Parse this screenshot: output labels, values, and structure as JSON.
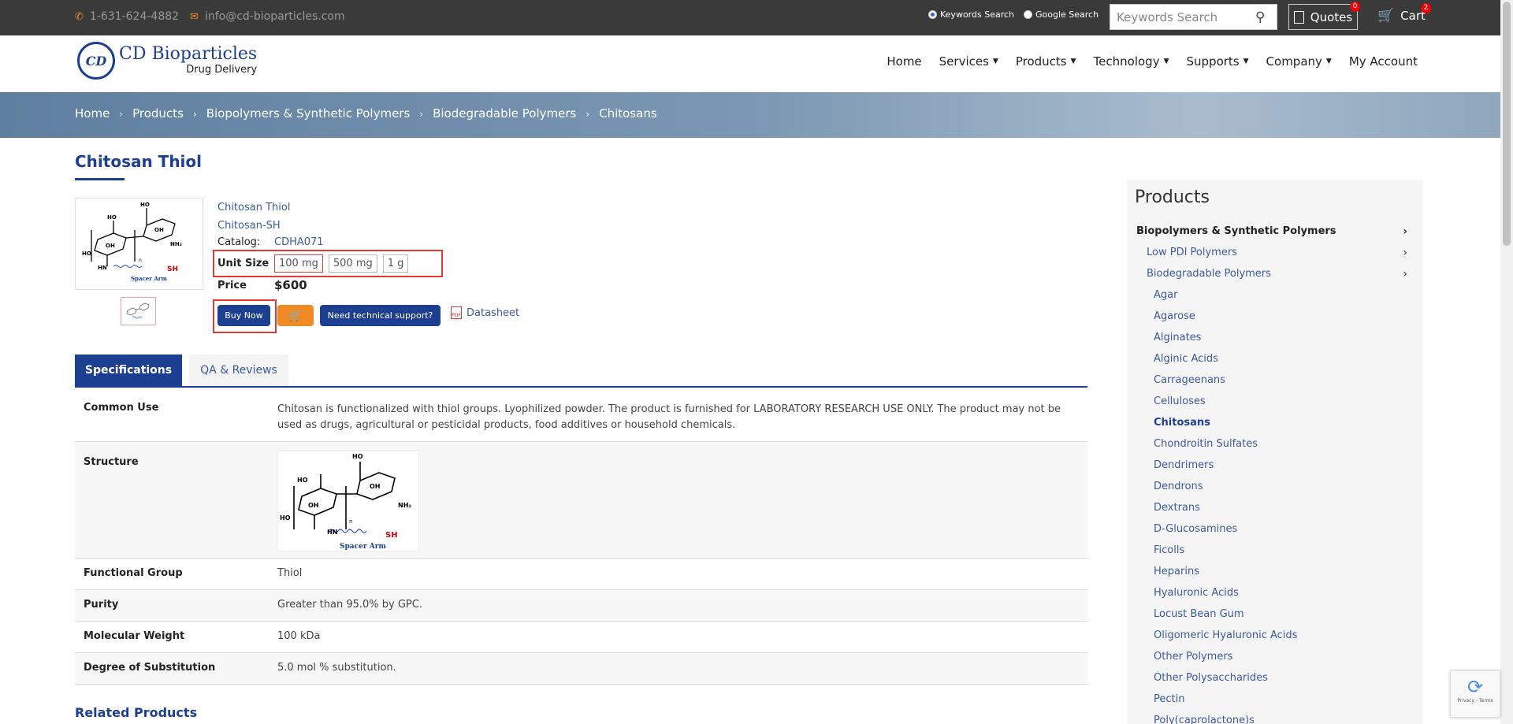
{
  "topbar": {
    "phone": "1-631-624-4882",
    "email": "info@cd-bioparticles.com",
    "radio_keywords": "Keywords Search",
    "radio_google": "Google Search",
    "search_placeholder": "Keywords Search",
    "quotes_label": "Quotes",
    "quotes_count": "0",
    "cart_label": "Cart",
    "cart_count": "2"
  },
  "logo": {
    "mark": "CD",
    "name": "CD Bioparticles",
    "subtitle": "Drug Delivery"
  },
  "nav": [
    "Home",
    "Services",
    "Products",
    "Technology",
    "Supports",
    "Company",
    "My Account"
  ],
  "breadcrumb": [
    "Home",
    "Products",
    "Biopolymers & Synthetic Polymers",
    "Biodegradable Polymers",
    "Chitosans"
  ],
  "product": {
    "title": "Chitosan Thiol",
    "name_link": "Chitosan Thiol",
    "alias_link": "Chitosan-SH",
    "catalog_label": "Catalog:",
    "catalog_value": "CDHA071",
    "unit_size_label": "Unit Size",
    "sizes": [
      "100 mg",
      "500 mg",
      "1 g"
    ],
    "price_label": "Price",
    "price_value": "$600",
    "buy_now": "Buy Now",
    "support": "Need technical support?",
    "datasheet": "Datasheet",
    "image_labels": {
      "ho": "HO",
      "oh": "OH",
      "nh2": "NH₂",
      "hn": "HN",
      "sh": "SH",
      "n": "n",
      "spacer": "Spacer Arm"
    }
  },
  "tabs": [
    "Specifications",
    "QA & Reviews"
  ],
  "specs": [
    {
      "k": "Common Use",
      "v": "Chitosan is functionalized with thiol groups. Lyophilized powder. The product is furnished for LABORATORY RESEARCH USE ONLY. The product may not be used as drugs, agricultural or pesticidal products, food additives or household chemicals."
    },
    {
      "k": "Structure",
      "v": ""
    },
    {
      "k": "Functional Group",
      "v": "Thiol"
    },
    {
      "k": "Purity",
      "v": "Greater than 95.0% by GPC."
    },
    {
      "k": "Molecular Weight",
      "v": "100 kDa"
    },
    {
      "k": "Degree of Substitution",
      "v": "5.0 mol % substitution."
    }
  ],
  "related_title": "Related Products",
  "sidebar": {
    "title": "Products",
    "items": [
      {
        "label": "Biopolymers & Synthetic Polymers",
        "level": 0,
        "arrow": true
      },
      {
        "label": "Low PDI Polymers",
        "level": 1,
        "arrow": true
      },
      {
        "label": "Biodegradable Polymers",
        "level": 1,
        "arrow": true
      },
      {
        "label": "Agar",
        "level": 2
      },
      {
        "label": "Agarose",
        "level": 2
      },
      {
        "label": "Alginates",
        "level": 2
      },
      {
        "label": "Alginic Acids",
        "level": 2
      },
      {
        "label": "Carrageenans",
        "level": 2
      },
      {
        "label": "Celluloses",
        "level": 2
      },
      {
        "label": "Chitosans",
        "level": 2,
        "current": true
      },
      {
        "label": "Chondroitin Sulfates",
        "level": 2
      },
      {
        "label": "Dendrimers",
        "level": 2
      },
      {
        "label": "Dendrons",
        "level": 2
      },
      {
        "label": "Dextrans",
        "level": 2
      },
      {
        "label": "D-Glucosamines",
        "level": 2
      },
      {
        "label": "Ficolls",
        "level": 2
      },
      {
        "label": "Heparins",
        "level": 2
      },
      {
        "label": "Hyaluronic Acids",
        "level": 2
      },
      {
        "label": "Locust Bean Gum",
        "level": 2
      },
      {
        "label": "Oligomeric Hyaluronic Acids",
        "level": 2
      },
      {
        "label": "Other Polymers",
        "level": 2
      },
      {
        "label": "Other Polysaccharides",
        "level": 2
      },
      {
        "label": "Pectin",
        "level": 2
      },
      {
        "label": "Poly(caprolactone)s",
        "level": 2
      }
    ]
  },
  "recaptcha": "Privacy - Terms",
  "colors": {
    "brand": "#1d3f91",
    "accent": "#f08a24",
    "highlight": "#e53935"
  }
}
